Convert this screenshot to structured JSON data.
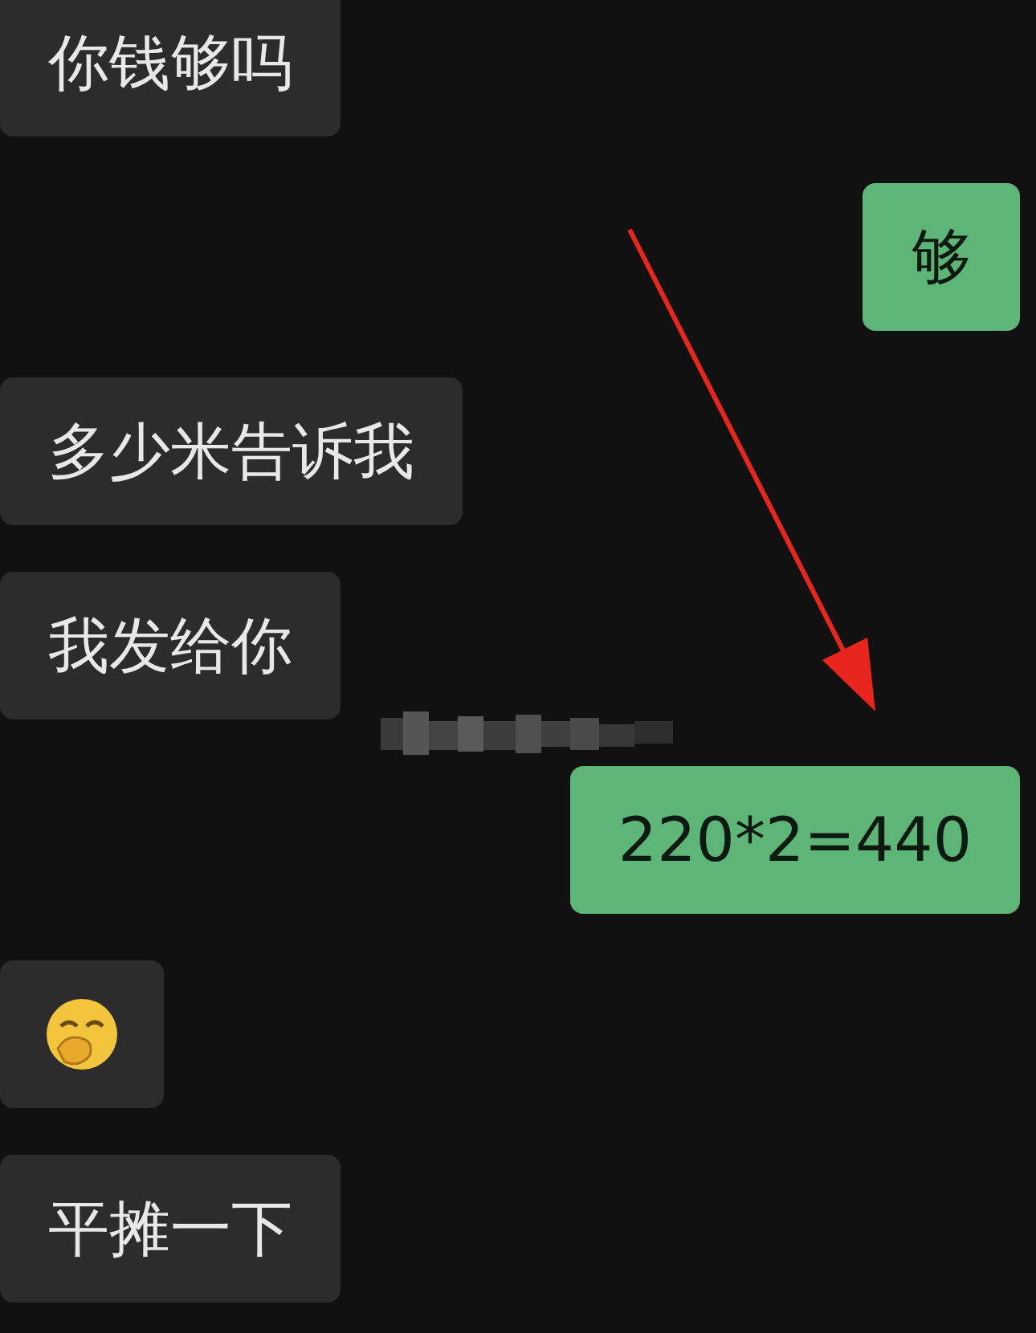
{
  "messages": [
    {
      "outgoing": false,
      "kind": "text",
      "text": "你钱够吗"
    },
    {
      "outgoing": true,
      "kind": "text",
      "text": "够"
    },
    {
      "outgoing": false,
      "kind": "text",
      "text": "多少米告诉我"
    },
    {
      "outgoing": false,
      "kind": "text",
      "text": "我发给你"
    },
    {
      "outgoing": true,
      "kind": "text",
      "text": "220*2=440"
    },
    {
      "outgoing": false,
      "kind": "emoji"
    },
    {
      "outgoing": false,
      "kind": "text",
      "text": "平摊一下"
    }
  ]
}
